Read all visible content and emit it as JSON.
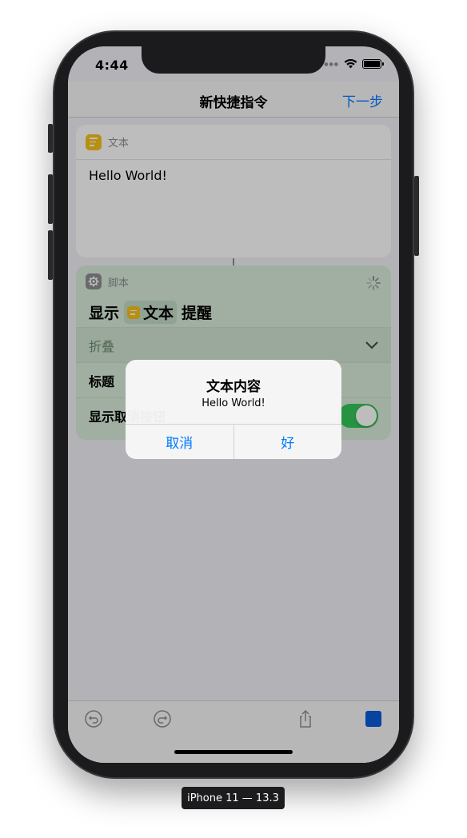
{
  "status_bar": {
    "time": "4:44"
  },
  "navbar": {
    "title": "新快捷指令",
    "next_label": "下一步"
  },
  "text_action": {
    "app_name": "文本",
    "content": "Hello World!"
  },
  "script_action": {
    "app_name": "脚本",
    "show_prefix": "显示",
    "token_label": "文本",
    "show_suffix": "提醒",
    "collapse_label": "折叠",
    "title_label": "标题",
    "show_cancel_label": "显示取消按钮",
    "show_cancel_on": true
  },
  "alert": {
    "title": "文本内容",
    "message": "Hello World!",
    "cancel_label": "取消",
    "ok_label": "好"
  },
  "device_label": "iPhone 11 — 13.3",
  "colors": {
    "accent": "#007aff",
    "text_icon": "#f7c21a",
    "script_card": "#d8ecd9",
    "toggle_on": "#34c759",
    "stop_button": "#0a5bd8"
  }
}
